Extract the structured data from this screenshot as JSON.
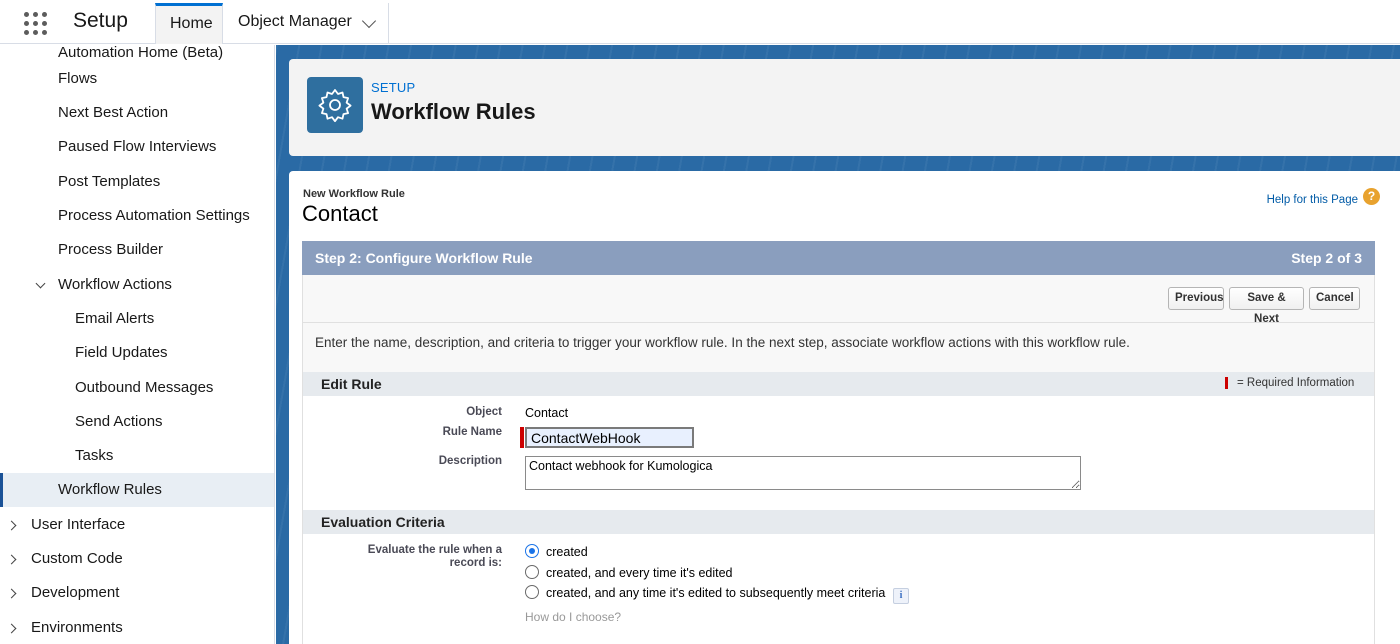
{
  "topbar": {
    "app_title": "Setup",
    "tabs": [
      {
        "label": "Home"
      },
      {
        "label": "Object Manager"
      }
    ]
  },
  "sidebar": {
    "cut_item": "Automation Home (Beta)",
    "items": [
      {
        "label": "Flows"
      },
      {
        "label": "Next Best Action"
      },
      {
        "label": "Paused Flow Interviews"
      },
      {
        "label": "Post Templates"
      },
      {
        "label": "Process Automation Settings"
      },
      {
        "label": "Process Builder"
      },
      {
        "label": "Workflow Actions"
      },
      {
        "label": "Email Alerts"
      },
      {
        "label": "Field Updates"
      },
      {
        "label": "Outbound Messages"
      },
      {
        "label": "Send Actions"
      },
      {
        "label": "Tasks"
      },
      {
        "label": "Workflow Rules"
      },
      {
        "label": "User Interface"
      },
      {
        "label": "Custom Code"
      },
      {
        "label": "Development"
      },
      {
        "label": "Environments"
      }
    ]
  },
  "header": {
    "section_label": "SETUP",
    "title": "Workflow Rules",
    "icon": "gear-icon"
  },
  "content": {
    "subtitle": "New Workflow Rule",
    "record_title": "Contact",
    "help_link": "Help for this Page",
    "help_icon": "?",
    "step_title": "Step 2: Configure Workflow Rule",
    "step_count": "Step 2 of 3",
    "buttons": {
      "previous": "Previous",
      "save_next": "Save & Next",
      "cancel": "Cancel"
    },
    "intro": "Enter the name, description, and criteria to trigger your workflow rule. In the next step, associate workflow actions with this workflow rule.",
    "edit_rule": {
      "heading": "Edit Rule",
      "required_info": "= Required Information",
      "object_label": "Object",
      "object_value": "Contact",
      "rule_name_label": "Rule Name",
      "rule_name_value": "ContactWebHook",
      "description_label": "Description",
      "description_value": "Contact webhook for Kumologica"
    },
    "evaluation": {
      "heading": "Evaluation Criteria",
      "label_line1": "Evaluate the rule when a",
      "label_line2": "record is:",
      "options": [
        {
          "label": "created",
          "selected": true
        },
        {
          "label": "created, and every time it's edited",
          "selected": false
        },
        {
          "label": "created, and any time it's edited to subsequently meet criteria",
          "selected": false
        }
      ],
      "info_icon": "i",
      "how_link": "How do I choose?"
    }
  },
  "colors": {
    "accent": "#0070d2",
    "step_bar": "#8a9ebe",
    "main_bg": "#2a6aa5",
    "required": "#cc0000",
    "help_icon": "#e8a22e"
  }
}
